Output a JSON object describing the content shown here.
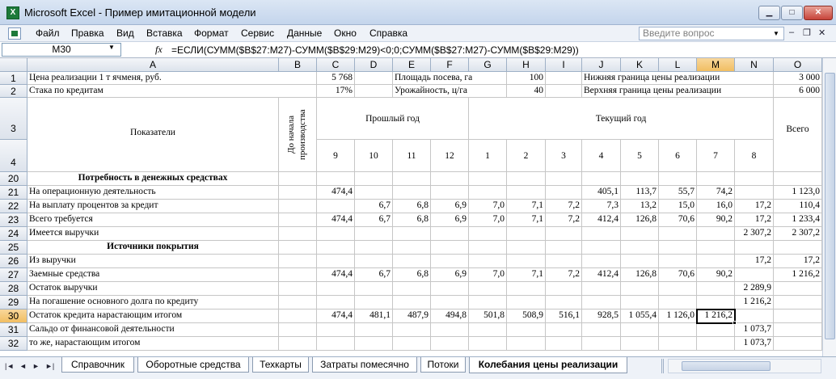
{
  "window": {
    "title": "Microsoft Excel - Пример имитационной модели",
    "app_icon": "excel-icon",
    "buttons": {
      "minimize": "▁",
      "maximize": "□",
      "close": "✕"
    }
  },
  "menu": {
    "items": [
      "Файл",
      "Правка",
      "Вид",
      "Вставка",
      "Формат",
      "Сервис",
      "Данные",
      "Окно",
      "Справка"
    ],
    "help_placeholder": "Введите вопрос",
    "mdi_buttons": {
      "minimize": "–",
      "restore": "❐",
      "close": "✕"
    }
  },
  "formula_bar": {
    "name_box": "M30",
    "fx": "fx",
    "formula": "=ЕСЛИ(СУММ($B$27:M27)-СУММ($B$29:M29)<0;0;СУММ($B$27:M27)-СУММ($B$29:M29))"
  },
  "columns": [
    "A",
    "B",
    "C",
    "D",
    "E",
    "F",
    "G",
    "H",
    "I",
    "J",
    "K",
    "L",
    "M",
    "N",
    "O"
  ],
  "selected": {
    "col": "M",
    "row": "30"
  },
  "header_rows": {
    "r1": {
      "A": "Цена реализации 1 т ячменя, руб.",
      "C": "5 768",
      "E": "Площадь посева, га",
      "H": "100",
      "J": "Нижняя граница цены реализации",
      "O": "3 000"
    },
    "r2": {
      "A": "Стака по кредитам",
      "C": "17%",
      "E": "Урожайность, ц/га",
      "H": "40",
      "J": "Верхняя граница цены реализации",
      "O": "6 000"
    },
    "r3": {
      "A": "Показатели",
      "B": "До начала производства",
      "prev_year": "Прошлый год",
      "cur_year": "Текущий год",
      "O": "Всего"
    },
    "r4": [
      "9",
      "10",
      "11",
      "12",
      "1",
      "2",
      "3",
      "4",
      "5",
      "6",
      "7",
      "8"
    ]
  },
  "rows": [
    {
      "num": "20",
      "A": "Потребность в денежных средствах",
      "bold": true,
      "center": true,
      "vals": [
        "",
        "",
        "",
        "",
        "",
        "",
        "",
        "",
        "",
        "",
        "",
        "",
        "",
        ""
      ]
    },
    {
      "num": "21",
      "A": "На операционную деятельность",
      "vals": [
        "",
        "474,4",
        "",
        "",
        "",
        "",
        "",
        "",
        "405,1",
        "113,7",
        "55,7",
        "74,2",
        "",
        "1 123,0"
      ]
    },
    {
      "num": "22",
      "A": "На выплату процентов за кредит",
      "vals": [
        "",
        "",
        "6,7",
        "6,8",
        "6,9",
        "7,0",
        "7,1",
        "7,2",
        "7,3",
        "13,2",
        "15,0",
        "16,0",
        "17,2",
        "110,4"
      ]
    },
    {
      "num": "23",
      "A": "Всего требуется",
      "vals": [
        "",
        "474,4",
        "6,7",
        "6,8",
        "6,9",
        "7,0",
        "7,1",
        "7,2",
        "412,4",
        "126,8",
        "70,6",
        "90,2",
        "17,2",
        "1 233,4"
      ]
    },
    {
      "num": "24",
      "A": "Имеется выручки",
      "vals": [
        "",
        "",
        "",
        "",
        "",
        "",
        "",
        "",
        "",
        "",
        "",
        "",
        "2 307,2",
        "2 307,2"
      ]
    },
    {
      "num": "25",
      "A": "Источники покрытия",
      "bold": true,
      "center": true,
      "vals": [
        "",
        "",
        "",
        "",
        "",
        "",
        "",
        "",
        "",
        "",
        "",
        "",
        "",
        ""
      ]
    },
    {
      "num": "26",
      "A": "Из выручки",
      "vals": [
        "",
        "",
        "",
        "",
        "",
        "",
        "",
        "",
        "",
        "",
        "",
        "",
        "17,2",
        "17,2"
      ]
    },
    {
      "num": "27",
      "A": "Заемные средства",
      "vals": [
        "",
        "474,4",
        "6,7",
        "6,8",
        "6,9",
        "7,0",
        "7,1",
        "7,2",
        "412,4",
        "126,8",
        "70,6",
        "90,2",
        "",
        "1 216,2"
      ]
    },
    {
      "num": "28",
      "A": "Остаток выручки",
      "vals": [
        "",
        "",
        "",
        "",
        "",
        "",
        "",
        "",
        "",
        "",
        "",
        "",
        "2 289,9",
        ""
      ]
    },
    {
      "num": "29",
      "A": "На погашение основного долга по кредиту",
      "vals": [
        "",
        "",
        "",
        "",
        "",
        "",
        "",
        "",
        "",
        "",
        "",
        "",
        "1 216,2",
        ""
      ]
    },
    {
      "num": "30",
      "A": "Остаток кредита нарастающим итогом",
      "vals": [
        "",
        "474,4",
        "481,1",
        "487,9",
        "494,8",
        "501,8",
        "508,9",
        "516,1",
        "928,5",
        "1 055,4",
        "1 126,0",
        "1 216,2",
        "",
        ""
      ]
    },
    {
      "num": "31",
      "A": "Сальдо от финансовой деятельности",
      "vals": [
        "",
        "",
        "",
        "",
        "",
        "",
        "",
        "",
        "",
        "",
        "",
        "",
        "1 073,7",
        ""
      ]
    },
    {
      "num": "32",
      "A": "то же, нарастающим итогом",
      "vals": [
        "",
        "",
        "",
        "",
        "",
        "",
        "",
        "",
        "",
        "",
        "",
        "",
        "1 073,7",
        ""
      ]
    }
  ],
  "sheet_tabs": {
    "nav": [
      "|◄",
      "◄",
      "►",
      "►|"
    ],
    "tabs": [
      "Справочник",
      "Оборотные средства",
      "Техкарты",
      "Затраты помесячно",
      "Потоки",
      "Колебания цены реализации"
    ],
    "active": 5
  }
}
